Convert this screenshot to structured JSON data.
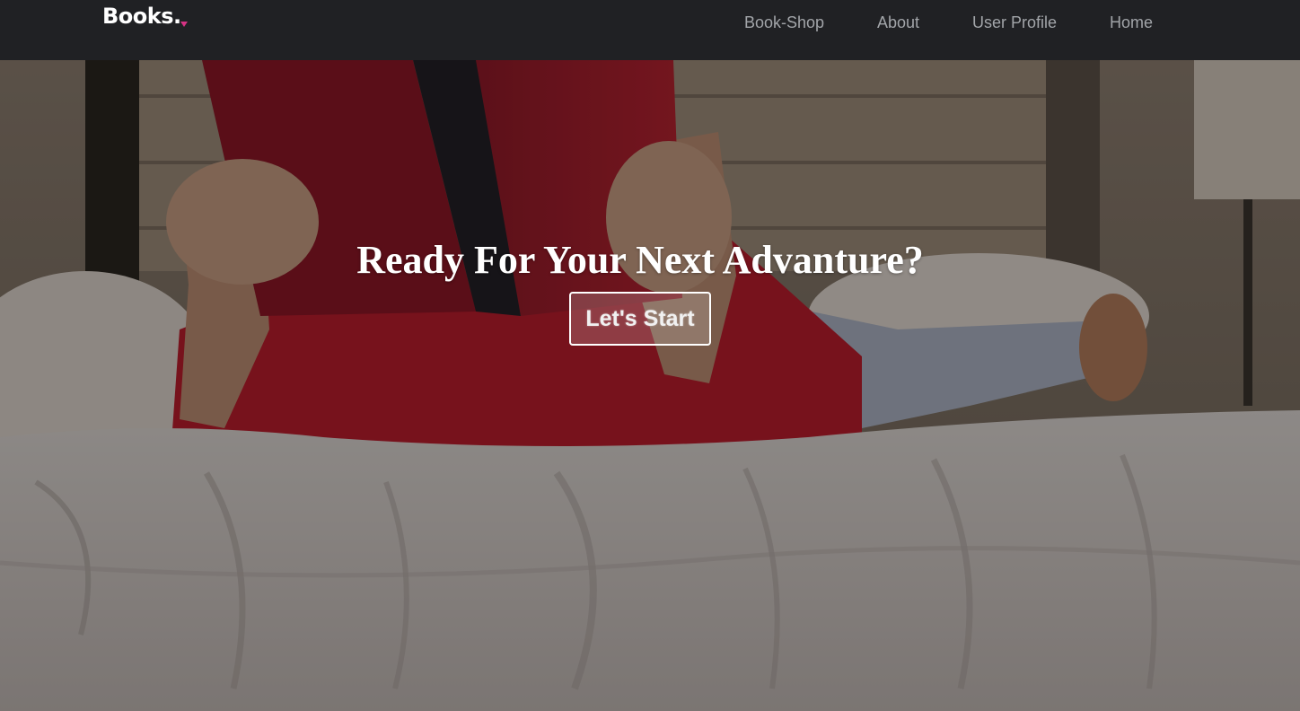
{
  "navbar": {
    "brand": "Books.",
    "links": [
      {
        "label": "Book-Shop"
      },
      {
        "label": "About"
      },
      {
        "label": "User Profile"
      },
      {
        "label": "Home"
      }
    ]
  },
  "hero": {
    "title": "Ready For Your Next Advanture?",
    "cta_label": "Let's Start"
  },
  "colors": {
    "navbar_bg": "#202124",
    "nav_link": "#a2a5a9",
    "brand_accent": "#d63384",
    "cta_border": "#ffffff"
  }
}
